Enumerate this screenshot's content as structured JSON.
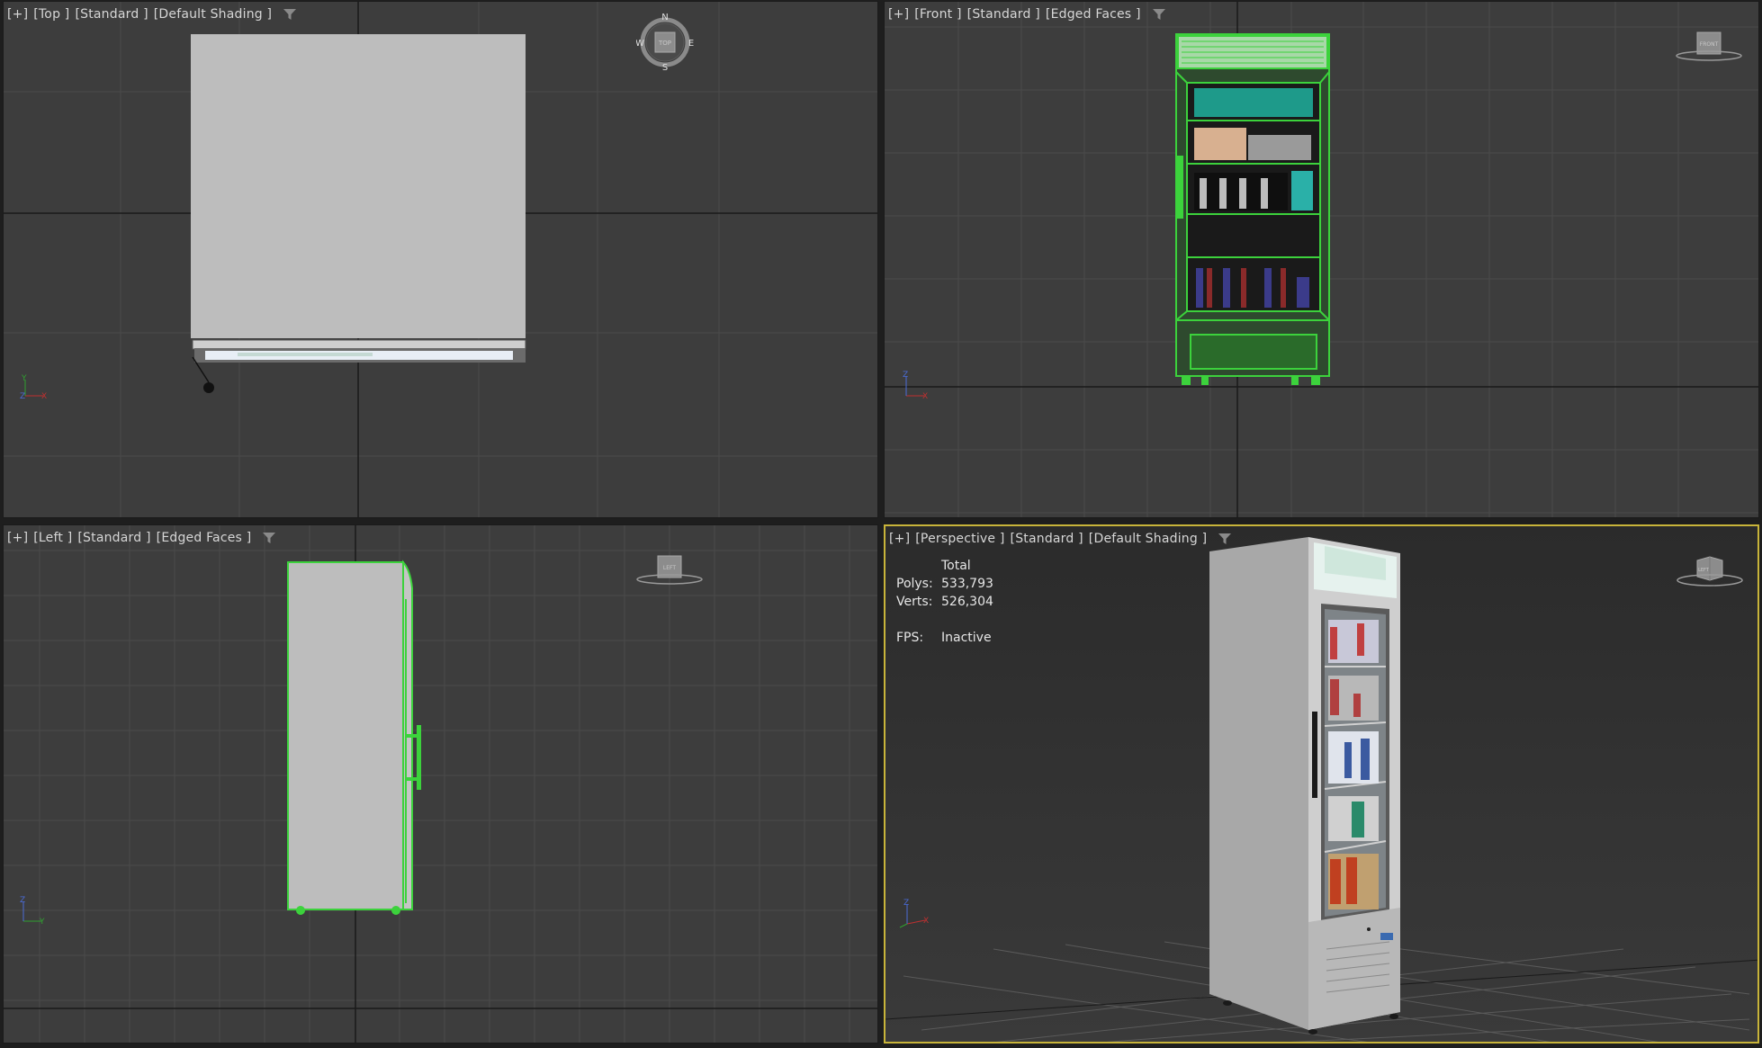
{
  "viewports": {
    "top": {
      "plus": "[+]",
      "view": "[Top ]",
      "mode": "[Standard ]",
      "shading": "[Default Shading ]",
      "compass": {
        "n": "N",
        "s": "S",
        "e": "E",
        "w": "W",
        "cube": "TOP"
      }
    },
    "front": {
      "plus": "[+]",
      "view": "[Front ]",
      "mode": "[Standard ]",
      "shading": "[Edged Faces ]",
      "cube": "FRONT"
    },
    "left": {
      "plus": "[+]",
      "view": "[Left ]",
      "mode": "[Standard ]",
      "shading": "[Edged Faces ]",
      "cube": "LEFT"
    },
    "perspective": {
      "plus": "[+]",
      "view": "[Perspective ]",
      "mode": "[Standard ]",
      "shading": "[Default Shading ]",
      "cube": "LEFT",
      "stats": {
        "header": "Total",
        "polys_label": "Polys:",
        "polys_value": "533,793",
        "verts_label": "Verts:",
        "verts_value": "526,304",
        "fps_label": "FPS:",
        "fps_value": "Inactive"
      }
    }
  },
  "colors": {
    "viewport_bg": "#3d3d3d",
    "grid_line": "#4a4a4a",
    "grid_major": "#1a1a1a",
    "selection_green": "#3cd23c",
    "active_border": "#c8b43a",
    "label_text": "#d6d6d6"
  }
}
